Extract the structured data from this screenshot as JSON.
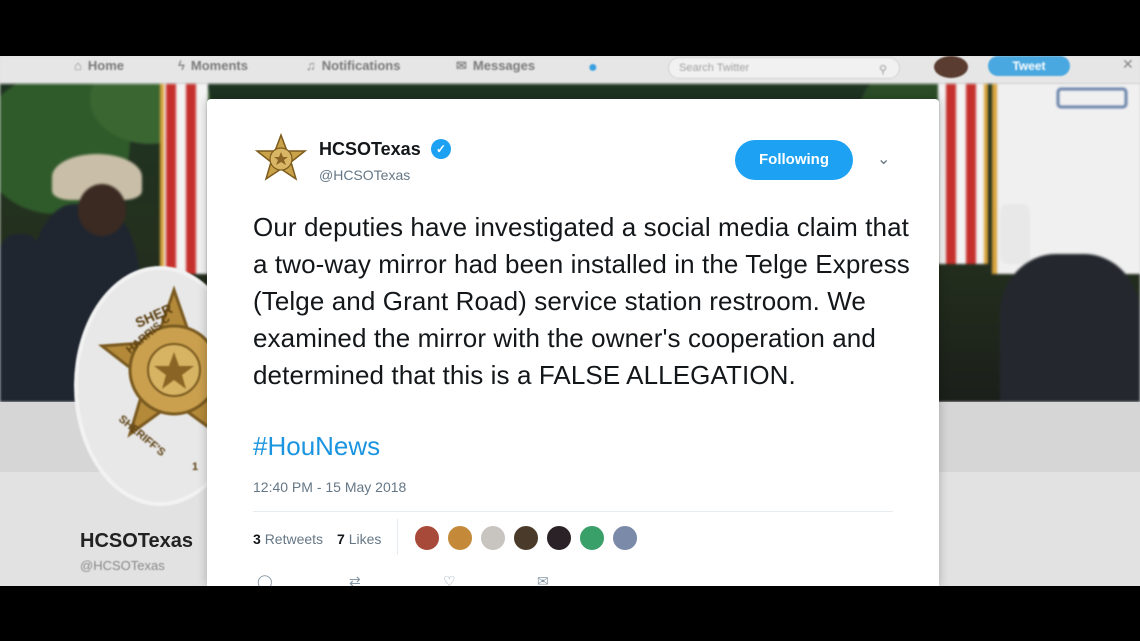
{
  "nav": {
    "home": "Home",
    "moments": "Moments",
    "notifications": "Notifications",
    "messages": "Messages",
    "search_placeholder": "Search Twitter",
    "tweet_button": "Tweet",
    "icons": [
      "home-icon",
      "lightning-icon",
      "bell-icon",
      "mail-icon",
      "bird-logo-icon",
      "search-icon",
      "close-icon"
    ]
  },
  "profile": {
    "name": "HCSOTexas",
    "handle": "@HCSOTexas",
    "badge_lettering": "HARRIS CO SHERIFF'S"
  },
  "tweet": {
    "author_name": "HCSOTexas",
    "author_handle": "@HCSOTexas",
    "verified": true,
    "follow_label": "Following",
    "text": "Our deputies have investigated a social media claim that a two-way mirror had been installed in the Telge Express (Telge and Grant Road) service station restroom. We examined the mirror with the owner's cooperation and determined that this is a FALSE ALLEGATION.",
    "hashtag": "#HouNews",
    "timestamp": "12:40 PM - 15 May 2018",
    "retweets_count": "3",
    "retweets_label": "Retweets",
    "likes_count": "7",
    "likes_label": "Likes",
    "likers_count": 7
  },
  "colors": {
    "accent": "#1da1f2",
    "hashtag": "#1b95e0",
    "text": "#14171a",
    "muted": "#657786"
  }
}
